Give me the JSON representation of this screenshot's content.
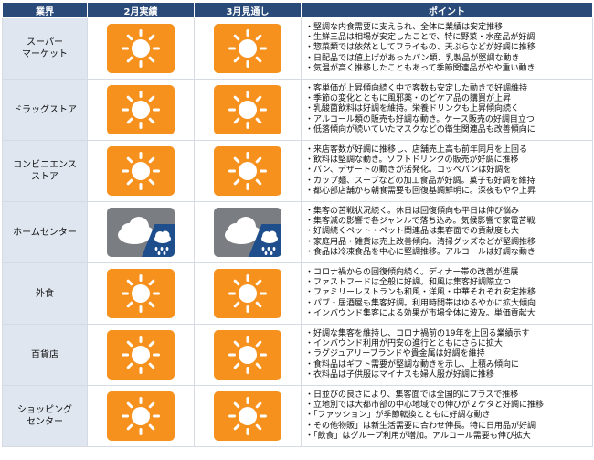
{
  "header": {
    "sector": "業界",
    "feb": "2月実績",
    "mar": "3月見通し",
    "points": "ポイント"
  },
  "rows": [
    {
      "sector_lines": [
        "スーパー",
        "マーケット"
      ],
      "feb_weather": "sunny-icon",
      "mar_weather": "sunny-icon",
      "points": [
        "・堅調な内食需要に支えられ、全体に業績は安定推移",
        "・生鮮三品は相場が安定したことで、特に野菜・水産品が好調",
        "・惣菜類では依然としてフライもの、天ぷらなどが好調に推移",
        "・日配品では値上げがあったパン類、乳製品が堅調な動き",
        "・気温が高く推移したこともあって季節関連品がやや重い動き"
      ]
    },
    {
      "sector_lines": [
        "ドラッグストア"
      ],
      "feb_weather": "sunny-icon",
      "mar_weather": "sunny-icon",
      "points": [
        "・客単価が上昇傾向続く中で客数も安定した動きで好調維持",
        "・季節の変化とともに風邪薬・のどケア品の購買が上昇",
        "・乳酸菌飲料は好調を維持。栄養ドリンクも上昇傾向続く",
        "・アルコール類の販売も好調な動き。ケース販売の好調目立つ",
        "・低落傾向が続いていたマスクなどの衛生関連品も改善傾向に"
      ]
    },
    {
      "sector_lines": [
        "コンビニエンス",
        "ストア"
      ],
      "feb_weather": "sunny-icon",
      "mar_weather": "sunny-icon",
      "points": [
        "・来店客数が好調に推移し、店舗売上高も前年同月を上回る",
        "・飲料は堅調な動き。ソフトドリンクの販売が好調に推移",
        "・パン、デザートの動きが活発化。コッペパンは好調を",
        "・カップ麺、スープなどの加工食品が好調。菓子も好調を維持",
        "・都心部店舗から朝食需要も回復基調鮮明に。深夜もやや上昇"
      ]
    },
    {
      "sector_lines": [
        "ホームセンター"
      ],
      "feb_weather": "cloudy-rain-icon",
      "mar_weather": "cloudy-rain-icon",
      "points": [
        "・集客の苦戦状況続く。休日は回復傾向も平日は伸び悩み",
        "・集客減の影響で各ジャンルで落ち込み。気候影響で家電苦戦",
        "・好調続くペット・ペット関連品は集客面での貢献度も大",
        "・家庭用品・雑貨は売上改善傾向。清掃グッズなどが堅調推移",
        "・食品は冷凍食品を中心に堅調推移。アルコールは好調な動き"
      ]
    },
    {
      "sector_lines": [
        "外食"
      ],
      "feb_weather": "sunny-icon",
      "mar_weather": "sunny-icon",
      "points": [
        "・コロナ禍からの回復傾向続く。ディナー帯の改善が進展",
        "・ファストフードは全般に好調。和風は集客好調際立つ",
        "・ファミリーレストランも和風・洋風・中華それぞれ安定推移",
        "・パブ・居酒屋も集客好調。利用時間帯はゆるやかに拡大傾向",
        "・インバウンド集客による効果が市場全体に波及。単価貢献大"
      ]
    },
    {
      "sector_lines": [
        "百貨店"
      ],
      "feb_weather": "sunny-icon",
      "mar_weather": "sunny-icon",
      "points": [
        "・好調な集客を維持し、コロナ禍前の19年を上回る業績示す",
        "・インバウンド利用が円安の進行とともにさらに拡大",
        "・ラグジュアリーブランドや貴金属は好調を維持",
        "・食料品はギフト需要が堅調な動きを示し、上積み傾向に",
        "・衣料品は子供服はマイナスも婦人服が好調に推移"
      ]
    },
    {
      "sector_lines": [
        "ショッピング",
        "センター"
      ],
      "feb_weather": "sunny-icon",
      "mar_weather": "sunny-icon",
      "points": [
        "・日並びの良さにより、集客面では全国的にプラスで推移",
        "・立地別では大都市部の中心地域での伸びが２ケタと好調に推移",
        "・「ファッション」が季節転換とともに好調な動き",
        "・その他物販」は新生活需要に合わせ伸長。特に日用品が好調",
        "・「飲食」はグループ利用が増加。アルコール需要も伸び拡大"
      ]
    }
  ]
}
